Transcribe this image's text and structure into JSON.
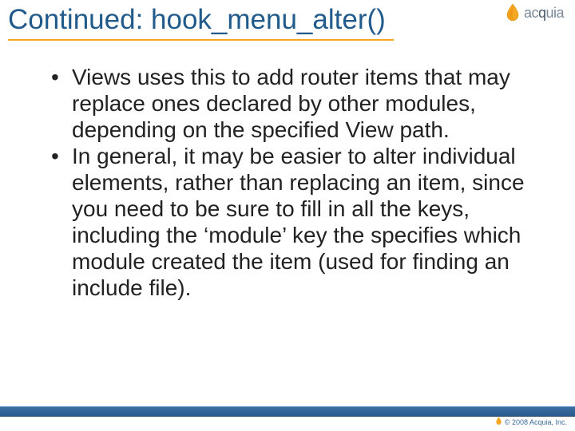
{
  "slide": {
    "title": "Continued: hook_menu_alter()",
    "bullets": [
      "Views uses this to add router items that may replace ones declared by other modules, depending on the specified View path.",
      "In general, it may be easier to alter individual elements, rather than replacing an item, since you need to be sure to fill in all the keys, including the ‘module’ key the specifies which module created the item (used for finding an include file)."
    ]
  },
  "brand": {
    "name": "acquia",
    "copyright": "© 2008 Acquia, Inc."
  },
  "colors": {
    "title": "#215b8b",
    "underline": "#f5a623",
    "footer_bar": "#2a5a8f"
  }
}
